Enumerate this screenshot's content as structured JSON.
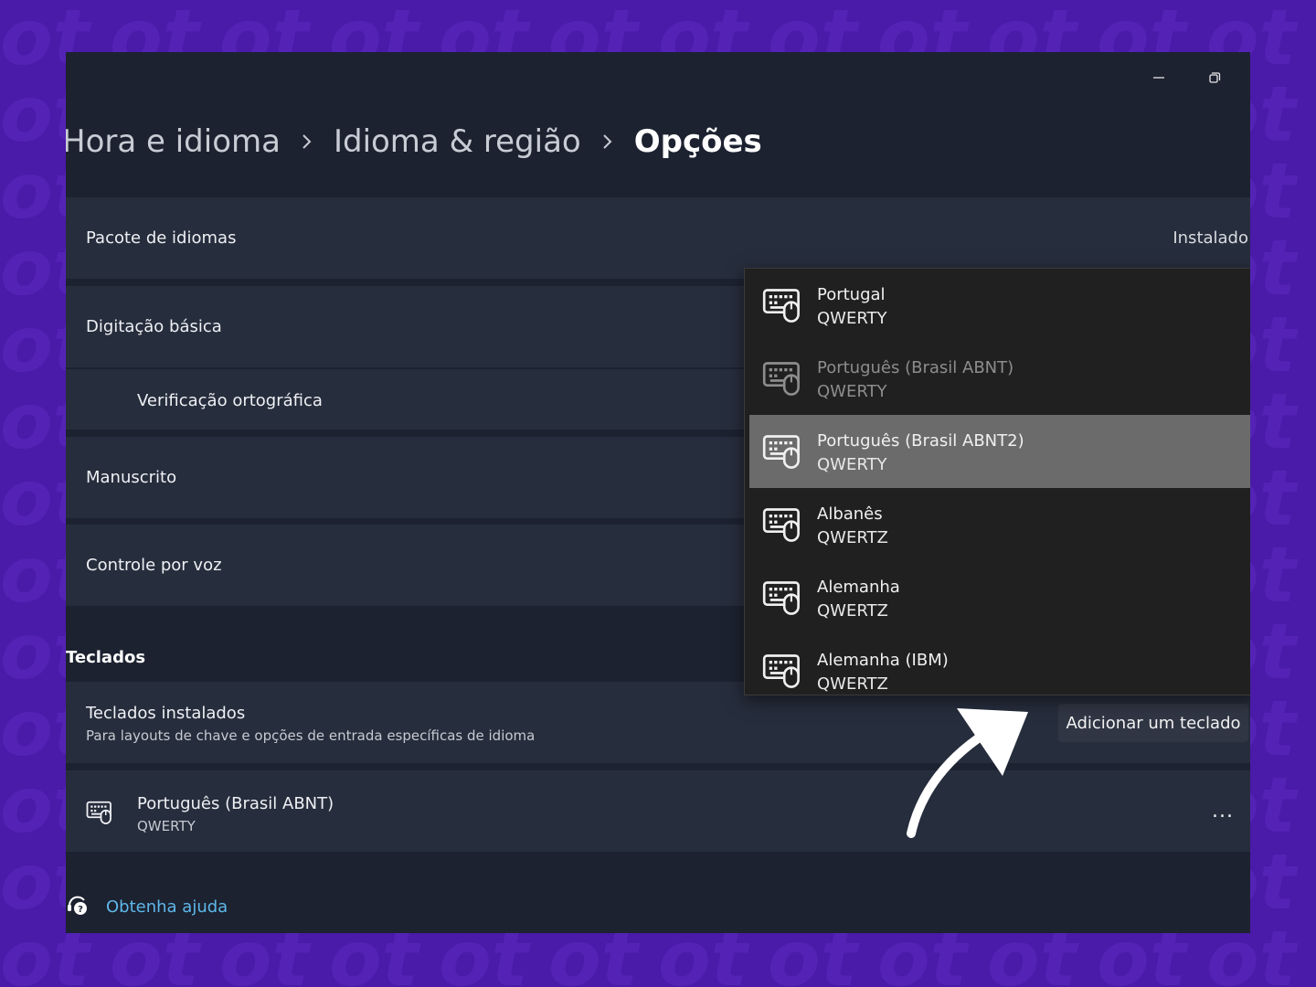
{
  "window": {
    "minimize_icon": "minimize-icon",
    "restore_icon": "restore-icon"
  },
  "breadcrumb": {
    "items": [
      "Hora e idioma",
      "Idioma & região"
    ],
    "current": "Opções"
  },
  "language_pack": {
    "label": "Pacote de idiomas",
    "status": "Instalado"
  },
  "basic_typing": {
    "label": "Digitação básica"
  },
  "spell_check": {
    "label": "Verificação ortográfica"
  },
  "handwriting": {
    "label": "Manuscrito"
  },
  "voice": {
    "label": "Controle por voz"
  },
  "keyboards": {
    "section_title": "Teclados",
    "installed_title": "Teclados instalados",
    "installed_desc": "Para layouts de chave e opções de entrada específicas de idioma",
    "add_button": "Adicionar um teclado",
    "installed_item": {
      "name": "Português (Brasil ABNT)",
      "layout": "QWERTY"
    },
    "more_label": "..."
  },
  "help": {
    "label": "Obtenha ajuda"
  },
  "dropdown": {
    "items": [
      {
        "name": "Portugal",
        "layout": "QWERTY",
        "state": "normal"
      },
      {
        "name": "Português (Brasil ABNT)",
        "layout": "QWERTY",
        "state": "disabled"
      },
      {
        "name": "Português (Brasil ABNT2)",
        "layout": "QWERTY",
        "state": "selected"
      },
      {
        "name": "Albanês",
        "layout": "QWERTZ",
        "state": "normal"
      },
      {
        "name": "Alemanha",
        "layout": "QWERTZ",
        "state": "normal"
      },
      {
        "name": "Alemanha (IBM)",
        "layout": "QWERTZ",
        "state": "normal"
      }
    ]
  },
  "colors": {
    "background": "#4a1aa8",
    "window": "#1c2230",
    "card": "#262d3c",
    "dropdown": "#202020",
    "selected": "#6b6b6b",
    "link": "#5fb8ea"
  }
}
